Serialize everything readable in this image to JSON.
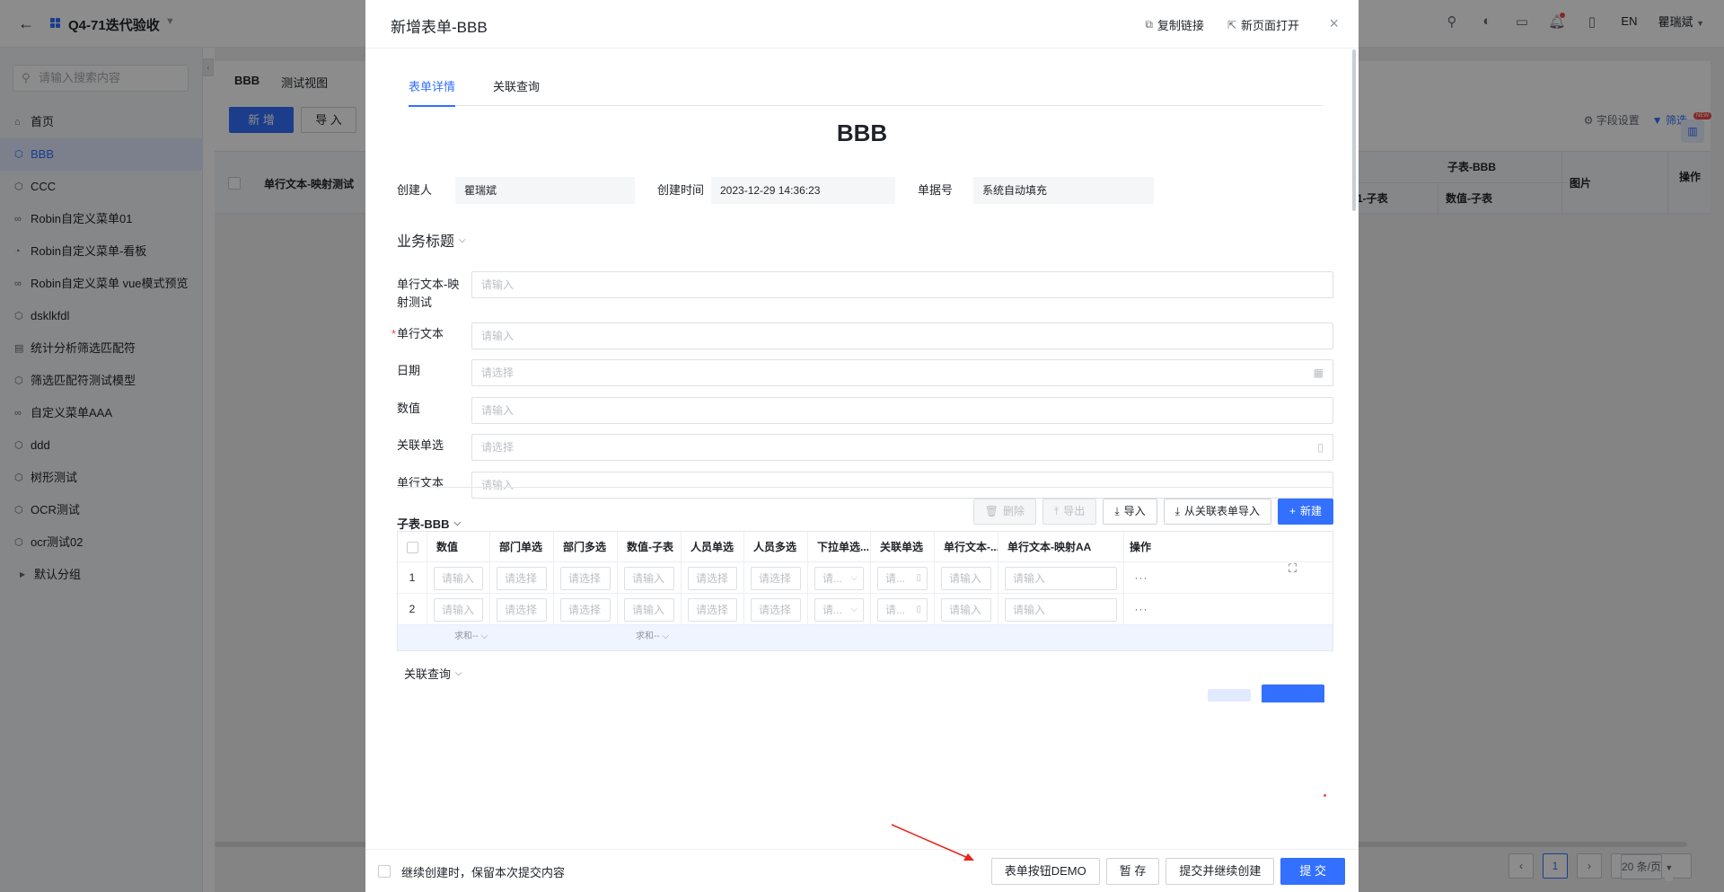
{
  "app": {
    "title": "Q4-71迭代验收",
    "lang": "EN",
    "user": "瞿瑞斌"
  },
  "sidebar": {
    "search_placeholder": "请输入搜索内容",
    "items": [
      {
        "label": "首页",
        "icon": "home-icon"
      },
      {
        "label": "BBB",
        "icon": "cube-icon",
        "active": true
      },
      {
        "label": "CCC",
        "icon": "cube-icon"
      },
      {
        "label": "Robin自定义菜单01",
        "icon": "link-icon"
      },
      {
        "label": "Robin自定义菜单-看板",
        "icon": "dashboard-icon"
      },
      {
        "label": "Robin自定义菜单 vue模式预览",
        "icon": "link-icon"
      },
      {
        "label": "dsklkfdl",
        "icon": "cube-icon"
      },
      {
        "label": "统计分析筛选匹配符",
        "icon": "chart-icon"
      },
      {
        "label": "筛选匹配符测试模型",
        "icon": "cube-icon"
      },
      {
        "label": "自定义菜单AAA",
        "icon": "link-icon"
      },
      {
        "label": "ddd",
        "icon": "cube-icon"
      },
      {
        "label": "树形测试",
        "icon": "cube-icon"
      },
      {
        "label": "OCR测试",
        "icon": "cube-icon"
      },
      {
        "label": "ocr测试02",
        "icon": "cube-icon"
      },
      {
        "label": "默认分组",
        "icon": "triangle-right-icon",
        "group": true
      }
    ]
  },
  "background": {
    "tabs": [
      "BBB",
      "测试视图"
    ],
    "new_label": "新 增",
    "import_label": "导 入",
    "field_settings": "字段设置",
    "filter": "筛选",
    "col1": "单行文本-映射测试",
    "group_header": "子表-BBB",
    "sub1": "1-子表",
    "sub2": "数值-子表",
    "img_col": "图片",
    "op_col": "操作",
    "page": "1",
    "page_size": "20 条/页"
  },
  "modal": {
    "title": "新增表单-BBB",
    "copy_link": "复制链接",
    "open_new": "新页面打开",
    "tabs": [
      "表单详情",
      "关联查询"
    ],
    "form_name": "BBB",
    "meta": {
      "creator_label": "创建人",
      "creator_value": "瞿瑞斌",
      "created_label": "创建时间",
      "created_value": "2023-12-29 14:36:23",
      "docno_label": "单据号",
      "docno_value": "系统自动填充"
    },
    "section_title": "业务标题",
    "fields": [
      {
        "label": "单行文本-映射测试",
        "placeholder": "请输入"
      },
      {
        "label": "单行文本",
        "placeholder": "请输入",
        "required": true
      },
      {
        "label": "日期",
        "placeholder": "请选择",
        "suffix": "calendar-icon"
      },
      {
        "label": "数值",
        "placeholder": "请输入"
      },
      {
        "label": "关联单选",
        "placeholder": "请选择",
        "suffix": "doc-icon"
      },
      {
        "label": "单行文本",
        "placeholder": "请输入"
      }
    ],
    "subtable": {
      "title": "子表-BBB",
      "tools": {
        "delete": "删除",
        "export": "导出",
        "import": "导入",
        "import_related": "从关联表单导入",
        "new": "新建"
      },
      "columns": [
        "数值",
        "部门单选",
        "部门多选",
        "数值-子表",
        "人员单选",
        "人员多选",
        "下拉单选...",
        "关联单选",
        "单行文本-...",
        "单行文本-映射AA",
        "操作"
      ],
      "rows": [
        {
          "index": "1",
          "cells": [
            "请输入",
            "请选择",
            "请选择",
            "请输入",
            "请选择",
            "请选择",
            "请...",
            "请...",
            "请输入",
            "请输入"
          ]
        },
        {
          "index": "2",
          "cells": [
            "请输入",
            "请选择",
            "请选择",
            "请输入",
            "请选择",
            "请选择",
            "请...",
            "请...",
            "请输入",
            "请输入"
          ]
        }
      ],
      "sum_label_1": "求和--",
      "sum_label_2": "求和--",
      "more": "···"
    },
    "related_title": "关联查询",
    "footer": {
      "keep_label": "继续创建时，保留本次提交内容",
      "demo_btn": "表单按钮DEMO",
      "save_btn": "暂 存",
      "submit_continue_btn": "提交并继续创建",
      "submit_btn": "提 交"
    }
  },
  "colors": {
    "primary": "#3370ff",
    "annotation_arrow": "#e8251b"
  }
}
